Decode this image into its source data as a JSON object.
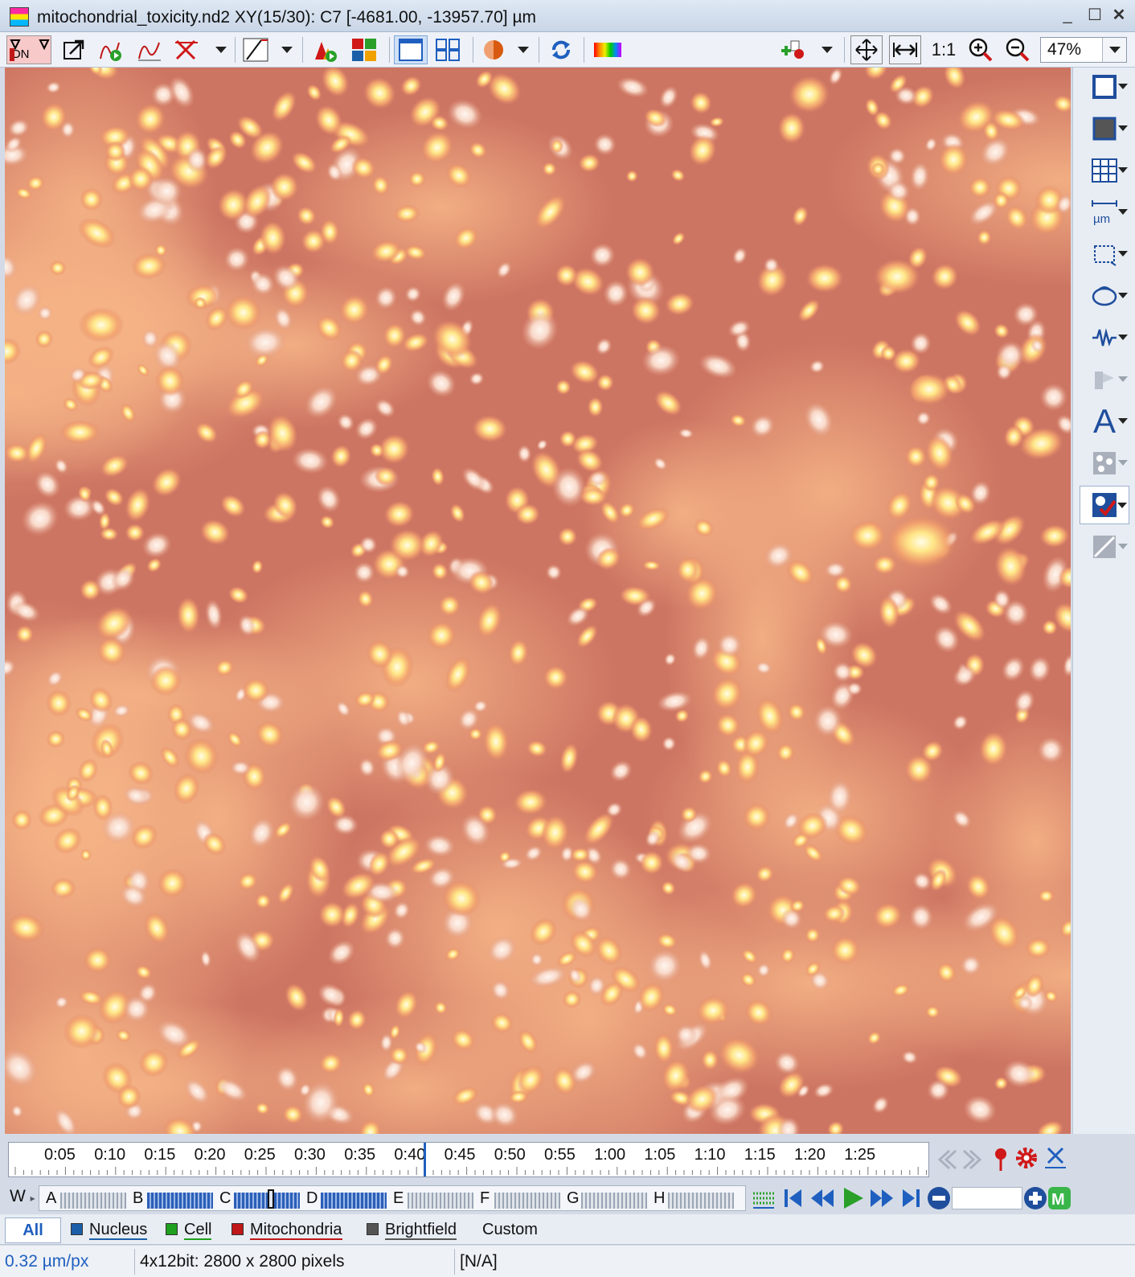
{
  "window": {
    "title": "mitochondrial_toxicity.nd2   XY(15/30): C7 [-4681.00, -13957.70] µm"
  },
  "toolbar": {
    "icons": [
      "lut-on",
      "export-arrow",
      "play-curve",
      "curve",
      "delete-curve",
      "line-profile",
      "triangle-play",
      "channel-grid",
      "single-view",
      "quad-view",
      "color-circle",
      "refresh",
      "spectrum",
      "add-marker",
      "fit-screen",
      "fit-width",
      "one-to-one",
      "zoom-in",
      "zoom-out"
    ],
    "one_to_one_label": "1:1",
    "zoom_value": "47%"
  },
  "timeline": {
    "labels": [
      "0:05",
      "0:10",
      "0:15",
      "0:20",
      "0:25",
      "0:30",
      "0:35",
      "0:40",
      "0:45",
      "0:50",
      "0:55",
      "1:00",
      "1:05",
      "1:10",
      "1:15",
      "1:20",
      "1:25"
    ],
    "current": "0:40"
  },
  "wells": {
    "row_label": "W",
    "columns": [
      "A",
      "B",
      "C",
      "D",
      "E",
      "F",
      "G",
      "H"
    ]
  },
  "channels": {
    "tabs": [
      {
        "label": "All",
        "color": ""
      },
      {
        "label": "Nucleus",
        "color": "#1b5fa8"
      },
      {
        "label": "Cell",
        "color": "#1fa01f"
      },
      {
        "label": "Mitochondria",
        "color": "#c01818"
      },
      {
        "label": "Brightfield",
        "color": "#555555"
      },
      {
        "label": "Custom",
        "color": ""
      }
    ]
  },
  "status": {
    "scale": "0.32 µm/px",
    "image_info": "4x12bit: 2800 x 2800 pixels",
    "value": "[N/A]"
  },
  "colors": {
    "accent": "#1f5fbf",
    "mitochondria": "#c01818",
    "image_bg": "#c9705c",
    "cell_glow": "#fff2a8"
  }
}
